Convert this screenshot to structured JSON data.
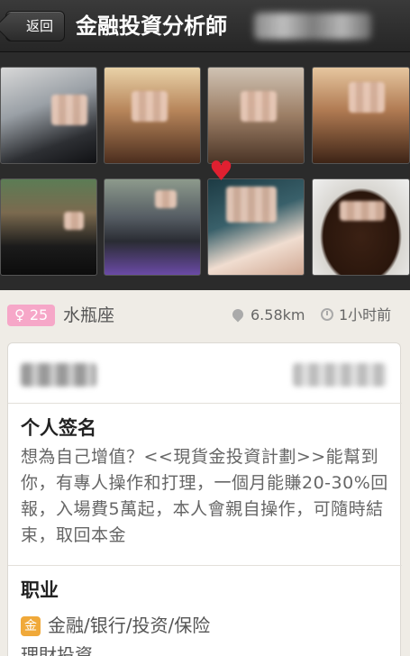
{
  "nav": {
    "back_label": "返回",
    "title": "金融投資分析師"
  },
  "photos": [
    "photo-1",
    "photo-2",
    "photo-3",
    "photo-4",
    "photo-5",
    "photo-6",
    "photo-7",
    "photo-8"
  ],
  "profile": {
    "gender_symbol": "♀",
    "age": "25",
    "zodiac": "水瓶座",
    "distance": "6.58km",
    "last_active": "1小时前"
  },
  "signature": {
    "heading": "个人签名",
    "text": "想為自己增值？<<現貨金投資計劃>>能幫到你，有專人操作和打理，一個月能賺20-30%回報，入場費5萬起，本人會親自操作，可隨時結束，取回本金"
  },
  "job": {
    "heading": "职业",
    "icon_label": "金",
    "category": "金融/银行/投资/保险",
    "title": "理財投資"
  },
  "colors": {
    "nav_bg": "#2b2b2b",
    "gender_badge": "#f6a7c8",
    "job_icon": "#f0a93a"
  }
}
